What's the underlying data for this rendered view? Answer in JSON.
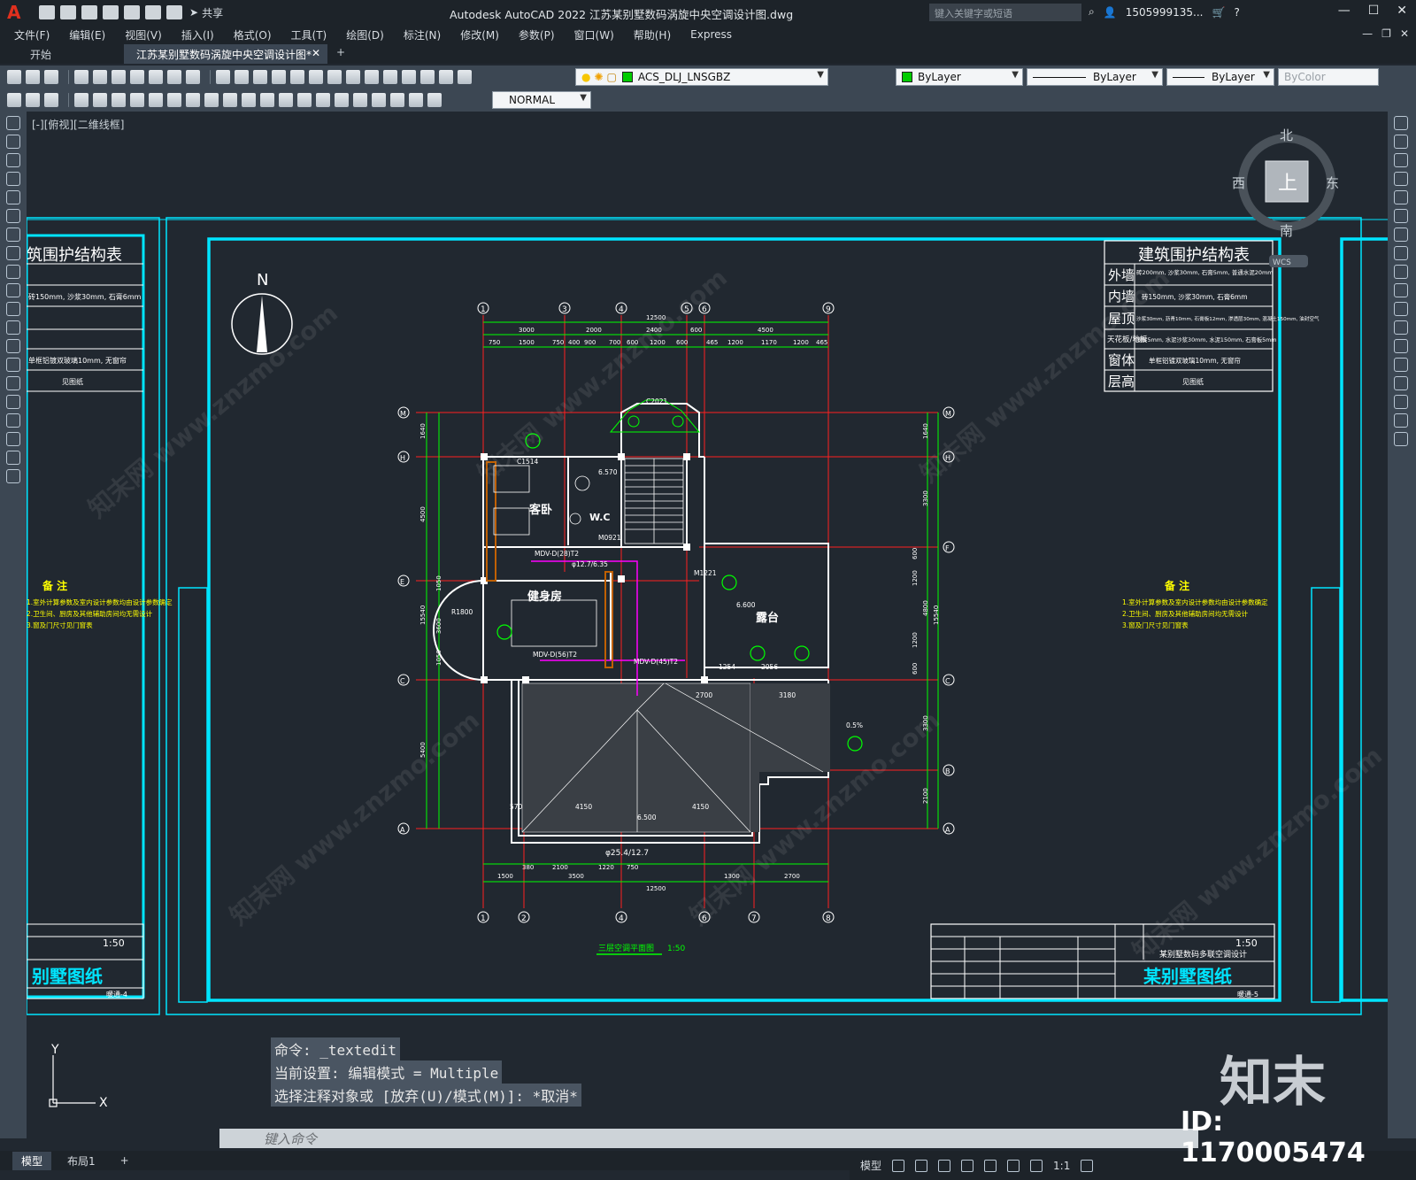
{
  "titlebar": {
    "app_title": "Autodesk AutoCAD 2022    江苏某别墅数码涡旋中央空调设计图.dwg",
    "share_label": "共享",
    "search_placeholder": "键入关键字或短语",
    "user": "1505999135...",
    "min": "—",
    "max": "☐",
    "close": "✕"
  },
  "menu": [
    "文件(F)",
    "编辑(E)",
    "视图(V)",
    "插入(I)",
    "格式(O)",
    "工具(T)",
    "绘图(D)",
    "标注(N)",
    "修改(M)",
    "参数(P)",
    "窗口(W)",
    "帮助(H)",
    "Express"
  ],
  "tabs": {
    "start": "开始",
    "active": "江苏某别墅数码涡旋中央空调设计图*",
    "close": "✕",
    "plus": "+"
  },
  "toolbar": {
    "layer": "ACS_DLJ_LNSGBZ",
    "color": "ByLayer",
    "linetype": "ByLayer",
    "lineweight": "ByLayer",
    "plotstyle": "ByColor",
    "dimstyle": "NORMAL"
  },
  "viewport": {
    "label": "[-][俯视][二维线框]"
  },
  "viewcube": {
    "north": "北",
    "south": "南",
    "east": "东",
    "west": "西",
    "face": "上",
    "wcs": "WCS"
  },
  "drawing": {
    "north_arrow": "N",
    "table_title": "建筑围护结构表",
    "table_title_partial": "筑围护结构表",
    "table_rows": [
      {
        "label": "外墙",
        "value": "砖200mm, 沙浆30mm, 石膏5mm, 普通水泥20mm"
      },
      {
        "label": "内墙",
        "value": "砖150mm, 沙浆30mm, 石膏6mm"
      },
      {
        "label": "屋顶",
        "value": "沙浆30mm, 沥青10mm, 石膏板12mm, 渗透层30mm, 混凝土150mm, 油封空气"
      },
      {
        "label": "天花板/地板",
        "value": "面砖5mm, 水泥沙浆30mm, 水泥150mm, 石膏板5mm"
      },
      {
        "label": "窗体",
        "value": "单框铝镀双玻璃10mm, 无窗帘"
      },
      {
        "label": "层高",
        "value": "见图纸"
      }
    ],
    "notes_title": "备  注",
    "notes": [
      "1.室外计算参数及室内设计参数均由设计参数确定",
      "2.卫生间、厨房及其他辅助房间均无需设计",
      "3.窗及门尺寸见门窗表"
    ],
    "titleblock_scale": "1:50",
    "titleblock_project": "某别墅数码多联空调设计",
    "titleblock_name": "某别墅图纸",
    "titleblock_name_partial": "别墅图纸",
    "titleblock_sheet": "暖通-5",
    "titleblock_sheet_left": "暖通-4",
    "plan_caption": "三层空调平面图",
    "plan_scale": "1:50",
    "rooms": [
      "客卧",
      "W.C",
      "健身房",
      "露台"
    ],
    "dims_top_total": "12500",
    "dims_top": [
      "3000",
      "2000",
      "2400",
      "600",
      "4500"
    ],
    "dims_top2": [
      "750",
      "1500",
      "750",
      "400",
      "900",
      "700",
      "600",
      "1200",
      "600",
      "465",
      "1200",
      "1170",
      "1200",
      "465"
    ],
    "dims_bottom": [
      "1500",
      "380",
      "2100",
      "3500",
      "1220",
      "750",
      "1300",
      "2700"
    ],
    "dims_bottom_total": "12500",
    "dims_left": [
      "1640",
      "4500",
      "1050",
      "3600",
      "1050",
      "15540",
      "5400"
    ],
    "dims_right": [
      "1640",
      "3300",
      "600",
      "1200",
      "4800",
      "1200",
      "600",
      "15540",
      "3300",
      "2100"
    ],
    "axis_top": [
      "1",
      "3",
      "4",
      "5",
      "6",
      "9"
    ],
    "axis_bottom": [
      "1",
      "2",
      "4",
      "6",
      "7",
      "8"
    ],
    "axis_left": [
      "M",
      "H",
      "E",
      "C",
      "A"
    ],
    "axis_right": [
      "M",
      "H",
      "F",
      "C",
      "B",
      "A"
    ],
    "pipe_labels": [
      "MDV-D(28)T2",
      "MDV-D(56)T2",
      "MDV-D(45)T2",
      "φ12.7/6.35",
      "φ25.4/12.7",
      "6.570",
      "6.600",
      "6.500",
      "R1800",
      "C2021",
      "C1514",
      "M0921",
      "M1221",
      "2700",
      "3180",
      "4150",
      "4150",
      "570",
      "1254",
      "2056"
    ],
    "roof_slope": "0.5%"
  },
  "command": {
    "history": [
      "命令: _textedit",
      "当前设置: 编辑模式 = Multiple",
      "选择注释对象或 [放弃(U)/模式(M)]: *取消*"
    ],
    "placeholder": "键入命令"
  },
  "layouts": [
    "模型",
    "布局1",
    "+"
  ],
  "status": {
    "model": "模型",
    "scale": "1:1"
  },
  "watermark": {
    "brand": "知末",
    "id": "ID: 1170005474",
    "diag": "知末网 www.znzmo.com"
  },
  "colors": {
    "frame": "#00e5ff",
    "plan": "#00ff00",
    "axis": "#ff2020",
    "wall": "#ffffff",
    "pipe": "#ff00ff",
    "text": "#ffffff",
    "yellow_note": "#ffff00"
  }
}
